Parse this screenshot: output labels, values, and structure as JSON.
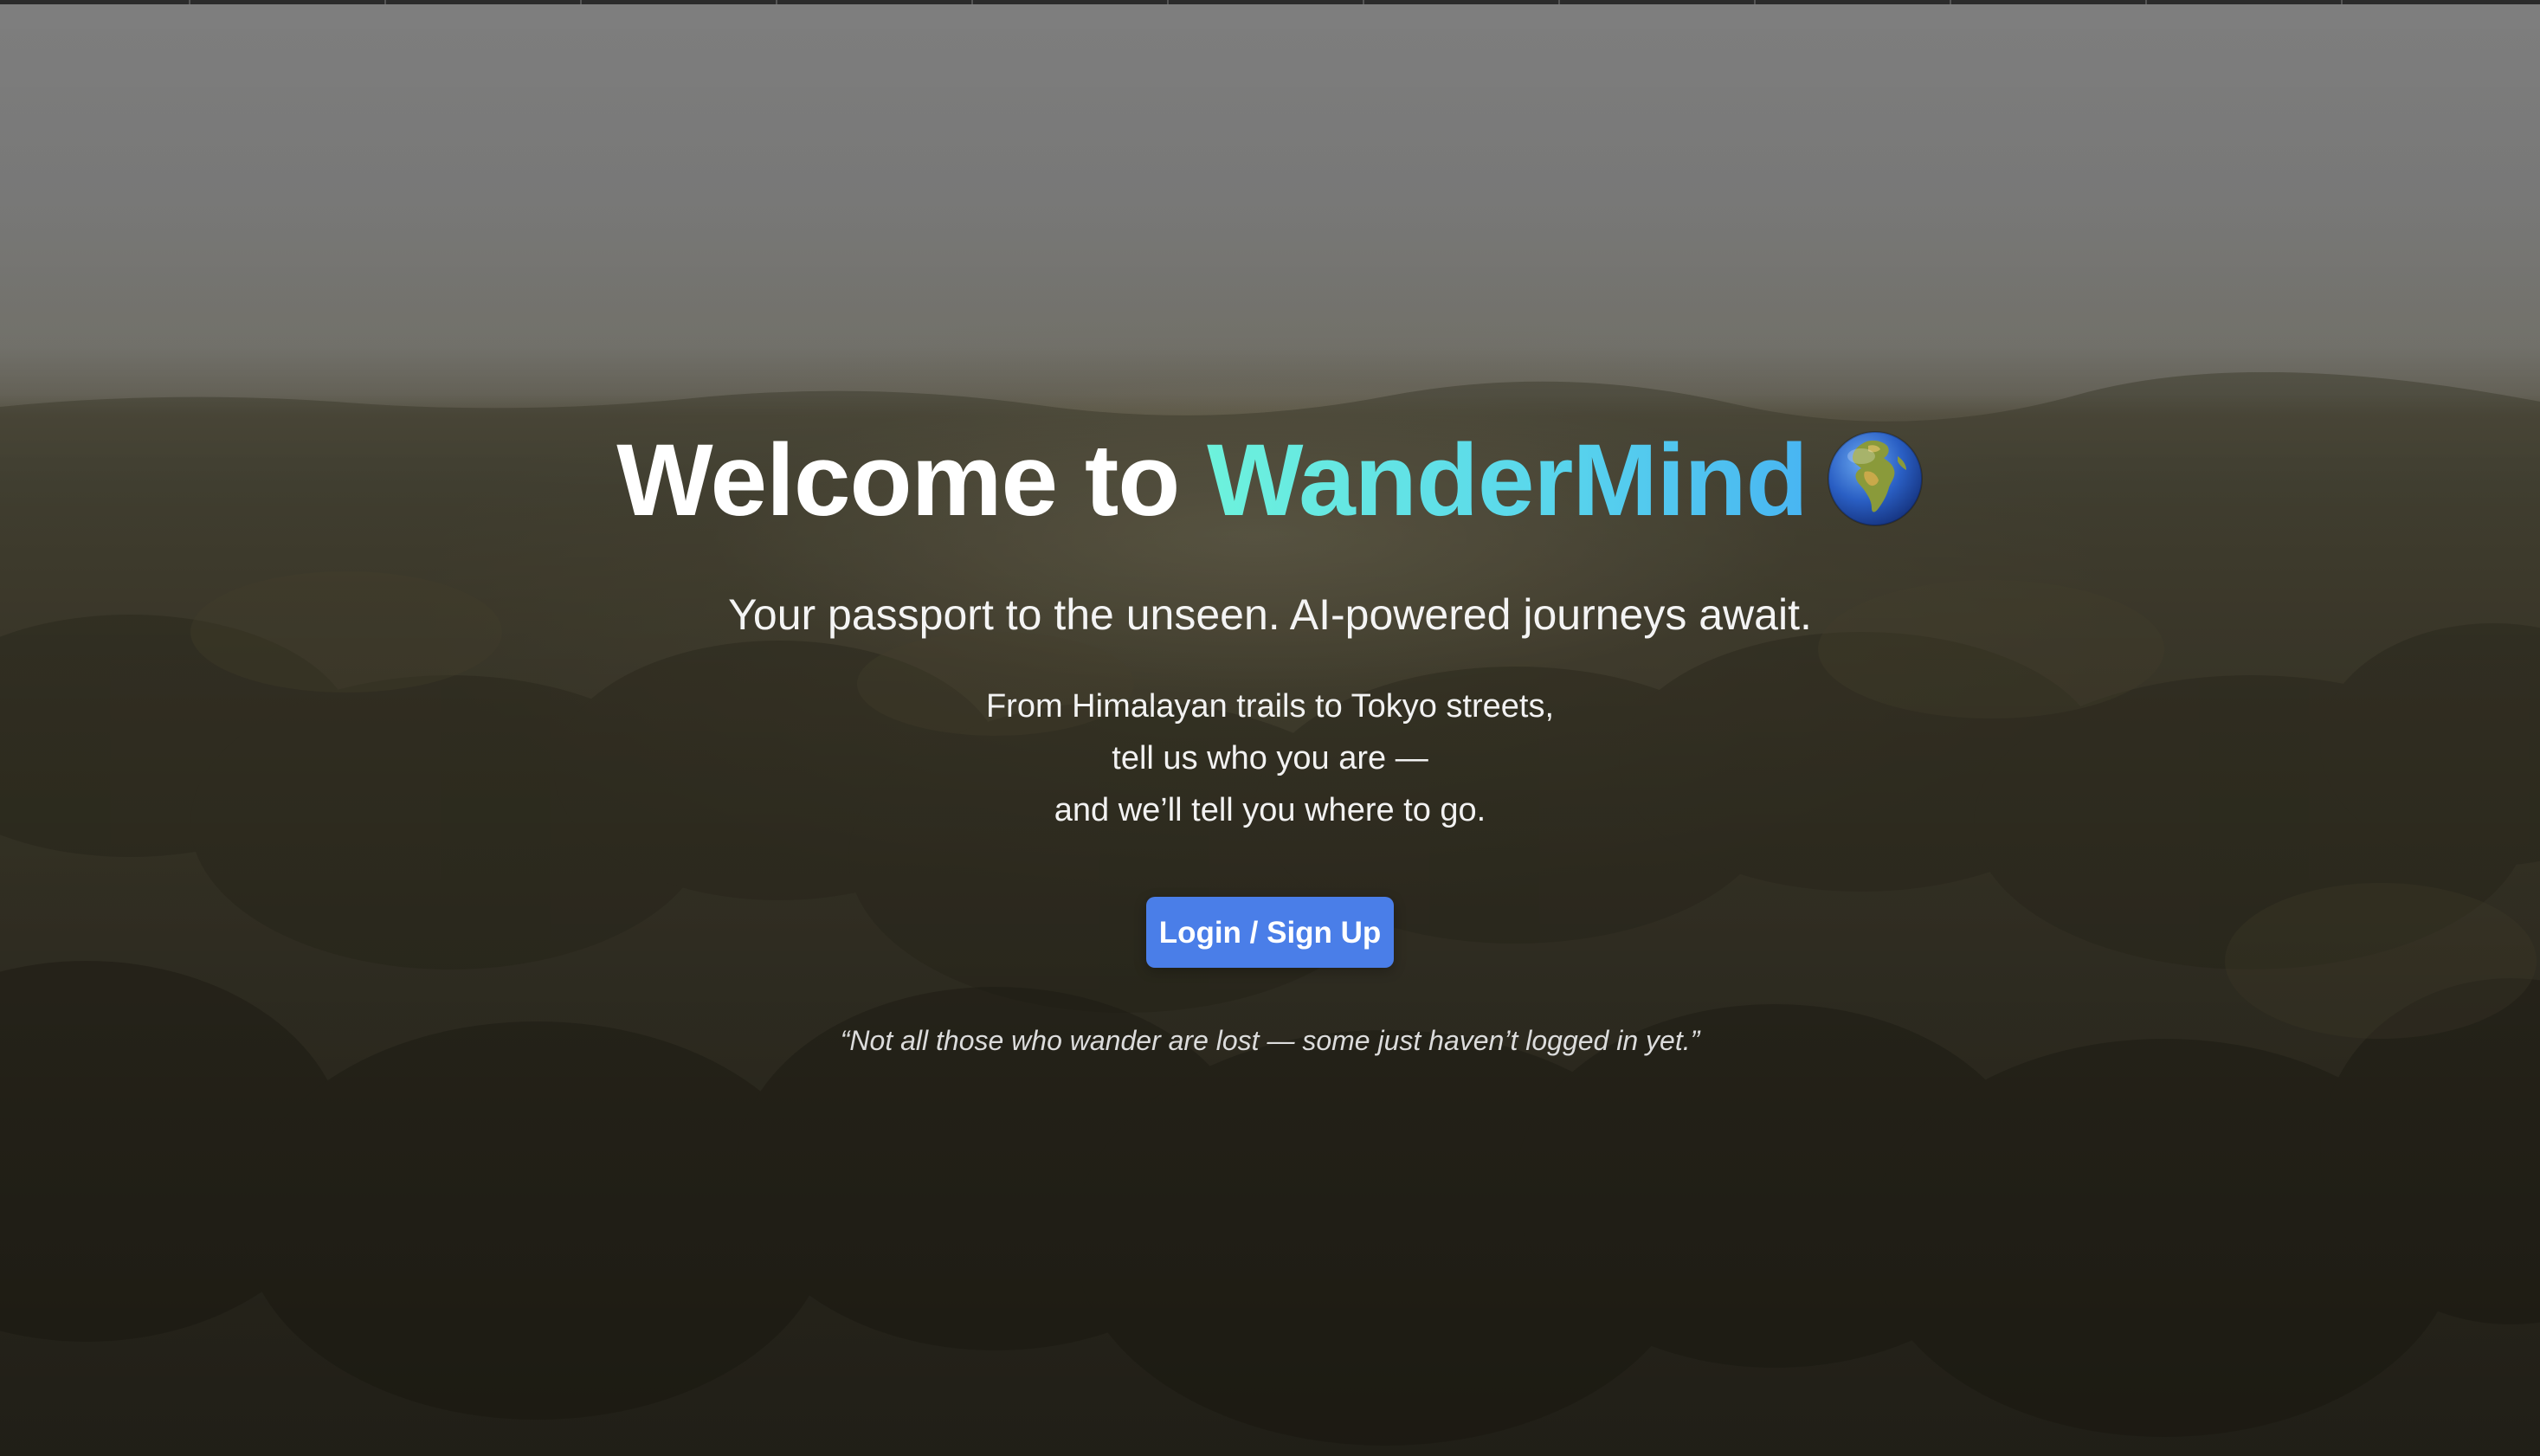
{
  "hero": {
    "title_prefix": "Welcome to ",
    "brand_name": "WanderMind",
    "tagline": "Your passport to the unseen. AI-powered journeys await.",
    "blurb_lines": [
      "From Himalayan trails to Tokyo streets,",
      "tell us who you are —",
      "and we’ll tell you where to go."
    ],
    "cta_label": "Login / Sign Up",
    "quote": "“Not all those who wander are lost — some just haven’t logged in yet.”"
  },
  "icons": {
    "globe": "globe-africa-europe-icon"
  },
  "colors": {
    "brand_gradient_start": "#6df2dc",
    "brand_gradient_end": "#48b5f2",
    "cta_background": "#4a7ee8",
    "text": "#ffffff"
  }
}
